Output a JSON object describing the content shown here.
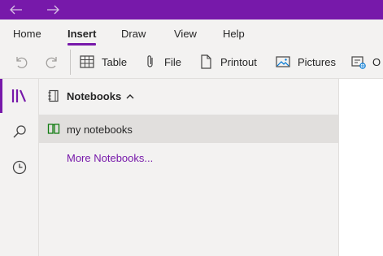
{
  "titlebar": {
    "back_icon": "arrow-left-icon",
    "forward_icon": "arrow-right-icon",
    "color": "#7719aa"
  },
  "ribbon": {
    "tabs": [
      {
        "label": "Home"
      },
      {
        "label": "Insert",
        "active": true
      },
      {
        "label": "Draw"
      },
      {
        "label": "View"
      },
      {
        "label": "Help"
      }
    ]
  },
  "toolbar": {
    "undo_icon": "undo-icon",
    "redo_icon": "redo-icon",
    "table_label": "Table",
    "file_label": "File",
    "printout_label": "Printout",
    "pictures_label": "Pictures",
    "online_label": "O"
  },
  "rail": {
    "items": [
      "notebooks-icon",
      "search-icon",
      "clock-icon"
    ]
  },
  "notebooks": {
    "title": "Notebooks",
    "items": [
      {
        "label": "my notebooks",
        "selected": true
      }
    ],
    "more_link": "More Notebooks..."
  },
  "colors": {
    "accent": "#7719aa",
    "notebook_green": "#107c10"
  }
}
